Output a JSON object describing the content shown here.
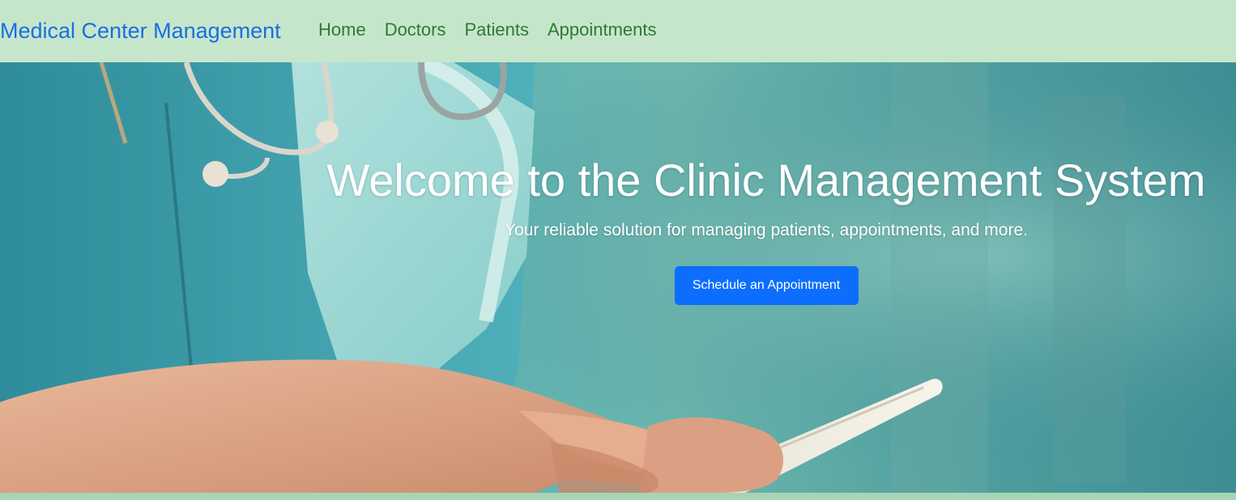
{
  "navbar": {
    "brand": "Medical Center Management",
    "links": [
      {
        "label": "Home"
      },
      {
        "label": "Doctors"
      },
      {
        "label": "Patients"
      },
      {
        "label": "Appointments"
      }
    ]
  },
  "hero": {
    "title": "Welcome to the Clinic Management System",
    "subtitle": "Your reliable solution for managing patients, appointments, and more.",
    "cta_label": "Schedule an Appointment"
  },
  "colors": {
    "navbar_bg": "#c6e6cb",
    "brand": "#1a6fe0",
    "nav_link": "#2e7a32",
    "cta_bg": "#0d6efd"
  },
  "icons": [
    "stethoscope",
    "tablet-device"
  ]
}
